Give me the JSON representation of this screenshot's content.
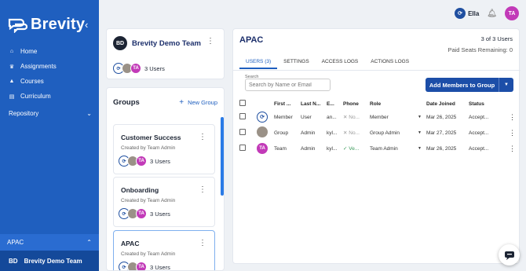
{
  "brand": {
    "name": "Brevity"
  },
  "nav": {
    "items": [
      {
        "label": "Home",
        "icon": "home-icon"
      },
      {
        "label": "Assignments",
        "icon": "trophy-icon"
      },
      {
        "label": "Courses",
        "icon": "graduation-cap-icon"
      },
      {
        "label": "Curriculum",
        "icon": "book-icon"
      }
    ],
    "repository": "Repository"
  },
  "team_selector": {
    "label": "APAC"
  },
  "current_team": {
    "initials": "BD",
    "name": "Brevity Demo Team"
  },
  "topbar": {
    "user": "Ella",
    "avatar": "TA"
  },
  "team_card": {
    "initials": "BD",
    "name": "Brevity Demo Team",
    "users": "3 Users"
  },
  "groups": {
    "title": "Groups",
    "new_label": "New Group",
    "items": [
      {
        "name": "Customer Success",
        "created": "Created by Team Admin",
        "users": "3 Users"
      },
      {
        "name": "Onboarding",
        "created": "Created by Team Admin",
        "users": "3 Users"
      },
      {
        "name": "APAC",
        "created": "Created by Team Admin",
        "users": "3 Users"
      }
    ]
  },
  "main": {
    "title": "APAC",
    "count": "3 of 3 Users",
    "seats": "Paid Seats Remaining: 0",
    "tabs": [
      "USERS (3)",
      "SETTINGS",
      "ACCESS LOGS",
      "ACTIONS LOGS"
    ],
    "search_label": "Search",
    "search_placeholder": "Search by Name or Email",
    "add_button": "Add Members to Group",
    "columns": [
      "First ...",
      "Last N...",
      "E...",
      "Phone",
      "Role",
      "Date Joined",
      "Status"
    ],
    "rows": [
      {
        "avatar": "brevity-logo",
        "first": "Member",
        "last": "User",
        "email": "an...",
        "phone": "No...",
        "role": "Member",
        "date": "Mar 26, 2025",
        "status": "Accept..."
      },
      {
        "avatar": "photo",
        "first": "Group",
        "last": "Admin",
        "email": "kyl...",
        "phone": "No...",
        "role": "Group Admin",
        "date": "Mar 27, 2025",
        "status": "Accept..."
      },
      {
        "avatar": "TA",
        "first": "Team",
        "last": "Admin",
        "email": "kyl...",
        "phone": "Ve...",
        "role": "Team Admin",
        "date": "Mar 26, 2025",
        "status": "Accept..."
      }
    ]
  },
  "colors": {
    "primary": "#1f5fbf",
    "avatar_pink": "#c23ab8",
    "background": "#eef1f5"
  }
}
